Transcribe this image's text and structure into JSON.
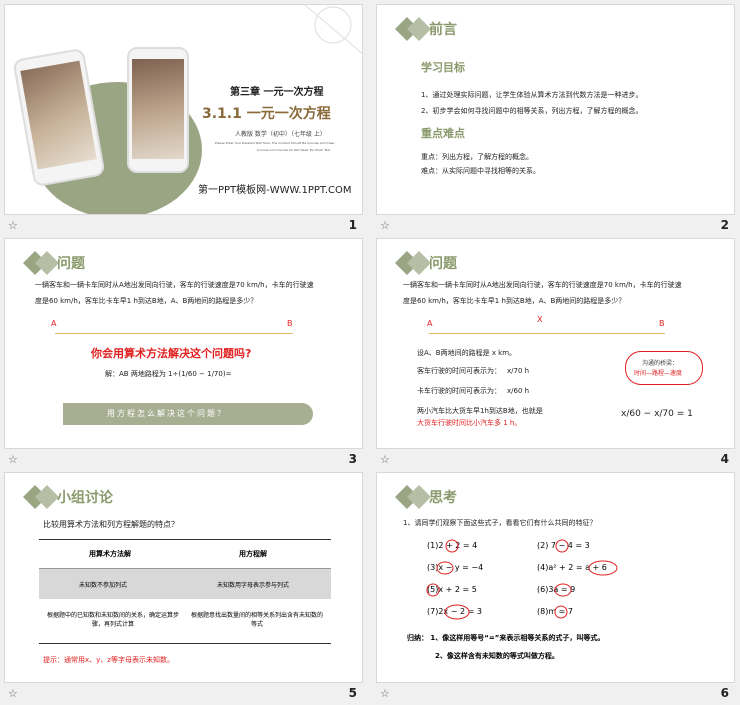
{
  "footer": {
    "star": "☆",
    "nums": [
      "1",
      "2",
      "3",
      "4",
      "5",
      "6"
    ]
  },
  "s1": {
    "chapter": "第三章 一元一次方程",
    "title": "3.1.1 一元一次方程",
    "edition": "人教版 数学（初中）（七年级 上）",
    "eng1": "Please Enter Your Detailed Text Here, The Content Should Be Concise And Clear,",
    "eng2": "Concise And Concise Do Not Need Too Much Text",
    "site": "第一PPT模板网-WWW.1PPT.COM"
  },
  "s2": {
    "header": "前言",
    "goal_title": "学习目标",
    "goal1": "1、通过处理实际问题，让学生体验从算术方法到代数方法是一种进步。",
    "goal2": "2、初步学会如何寻找问题中的相等关系，列出方程，了解方程的概念。",
    "key_title": "重点难点",
    "key1": "重点：列出方程，了解方程的概念。",
    "key2": "难点：从实际问题中寻找相等的关系。"
  },
  "s3": {
    "header": "问题",
    "problem1": "一辆客车和一辆卡车同时从A地出发同向行驶，客车的行驶速度是70 km/h，卡车的行驶速",
    "problem2": "度是60 km/h，客车比卡车早1 h到达B地，A、B两地间的路程是多少？",
    "labelA": "A",
    "labelB": "B",
    "question": "你会用算术方法解决这个问题吗?",
    "solution": "解：AB 两地路程为 1÷(1/60 − 1/70)=",
    "banner": "用方程怎么解决这个问题？"
  },
  "s4": {
    "header": "问题",
    "problem1": "一辆客车和一辆卡车同时从A地出发同向行驶，客车的行驶速度是70 km/h，卡车的行驶速",
    "problem2": "度是60 km/h，客车比卡车早1 h到达B地，A、B两地间的路程是多少？",
    "labelA": "A",
    "labelX": "X",
    "labelB": "B",
    "line1": "设A、B两地间的路程是 x km。",
    "line2": "客车行驶的时间可表示为：",
    "frac2": "x/70 h",
    "line3": "卡车行驶的时间可表示为：",
    "frac3": "x/60 h",
    "line4a": "两小汽车比大货车早1h到达B地，也就是",
    "line4b": "大货车行驶时间比小汽车多 1 h。",
    "cloud1": "沟通的桥梁：",
    "cloud2": "时间—路程—速度",
    "equation": "x/60 − x/70 = 1"
  },
  "s5": {
    "header": "小组讨论",
    "question": "比较用算术方法和列方程解题的特点？",
    "col1": "用算术方法解",
    "col2": "用方程解",
    "r1c1": "未知数不参加列式",
    "r1c2": "未知数用字母表示参与列式",
    "r2c1": "根据题中的已知数和未知数间的关系，确定运算步骤，再列式计算",
    "r2c2": "根据题意找出数量间的相等关系列出含有未知数的等式",
    "hint": "提示：通常用x、y、z等字母表示未知数。"
  },
  "s6": {
    "header": "思考",
    "question": "1、请同学们观察下面这些式子，看看它们有什么共同的特征？",
    "items": [
      "(1)2 + 2 = 4",
      "(2) 7 − 4 = 3",
      "(3)x − y = −4",
      "(4)a² + 2 = a + 6",
      "(5)x + 2 = 5",
      "(6)3a = 9",
      "(7)2x − 2 = 3",
      "(8)m = 7"
    ],
    "conclusion1": "归纳：   1、像这样用等号“=”来表示相等关系的式子，叫等式。",
    "conclusion2": "2、像这样含有未知数的等式叫做方程。"
  },
  "colors": {
    "green": "#8a9a6c",
    "red": "#e02020",
    "banner": "#a7ae92"
  }
}
